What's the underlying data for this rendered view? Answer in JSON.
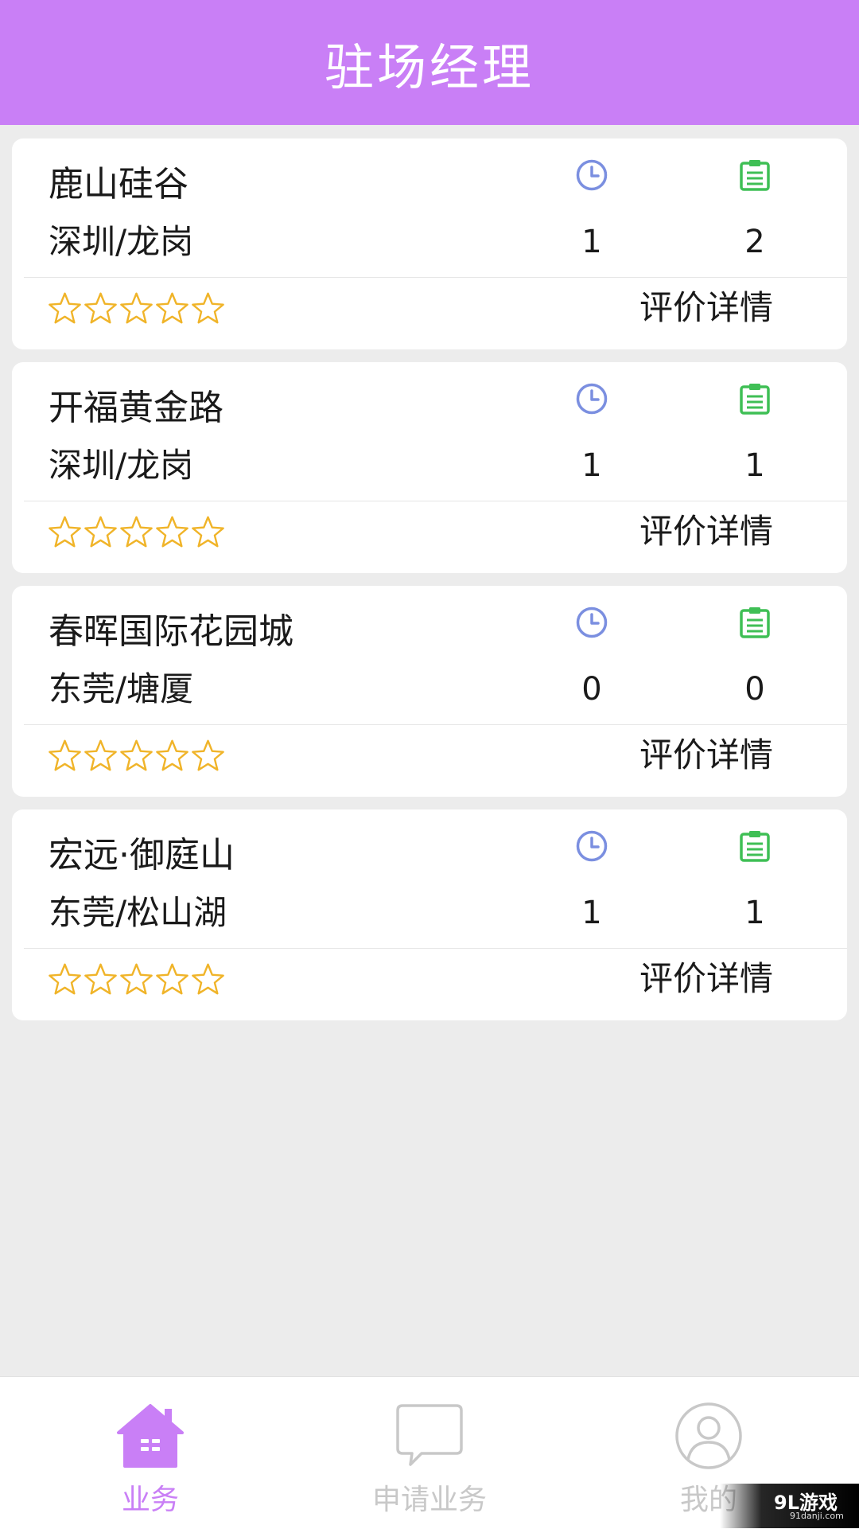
{
  "header": {
    "title": "驻场经理"
  },
  "projects": [
    {
      "name": "鹿山硅谷",
      "location": "深圳/龙岗",
      "pending": "1",
      "completed": "2",
      "rating": 0,
      "review_label": "评价详情"
    },
    {
      "name": "开福黄金路",
      "location": "深圳/龙岗",
      "pending": "1",
      "completed": "1",
      "rating": 0,
      "review_label": "评价详情"
    },
    {
      "name": "春晖国际花园城",
      "location": "东莞/塘厦",
      "pending": "0",
      "completed": "0",
      "rating": 0,
      "review_label": "评价详情"
    },
    {
      "name": "宏远·御庭山",
      "location": "东莞/松山湖",
      "pending": "1",
      "completed": "1",
      "rating": 0,
      "review_label": "评价详情"
    }
  ],
  "rating_max": 5,
  "icons": {
    "pending": "clock-icon",
    "completed": "clipboard-icon",
    "rating": "star-outline-icon"
  },
  "tabbar": {
    "tabs": [
      {
        "label": "业务",
        "icon": "home-icon",
        "active": true
      },
      {
        "label": "申请业务",
        "icon": "chat-bubble-icon",
        "active": false
      },
      {
        "label": "我的",
        "icon": "user-icon",
        "active": false
      }
    ]
  },
  "watermark": {
    "logo": "9L游戏",
    "url": "91danji.com"
  },
  "colors": {
    "primary": "#c97ff6",
    "clock": "#7b8fe0",
    "clipboard": "#3fbf55",
    "star": "#f0b429",
    "tab_inactive": "#c8c8c8"
  }
}
